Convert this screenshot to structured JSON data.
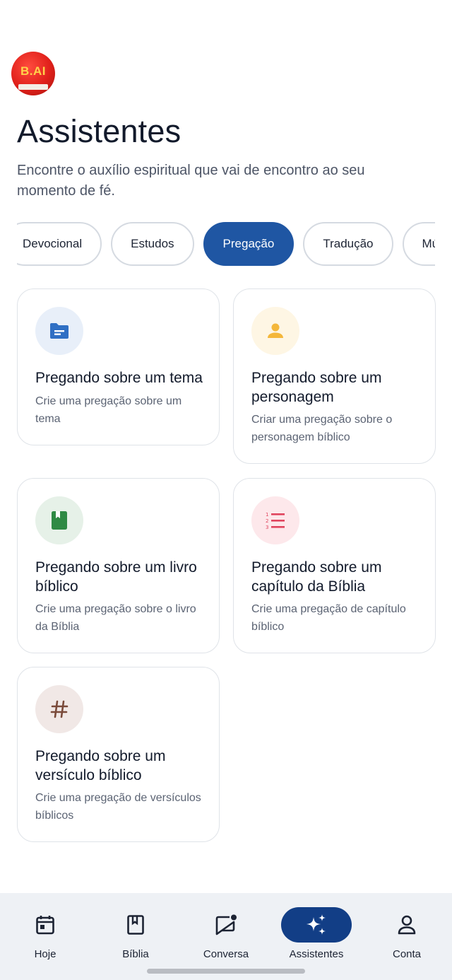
{
  "app": {
    "avatar_text": "B.AI"
  },
  "header": {
    "title": "Assistentes",
    "subtitle": "Encontre o auxílio espiritual que vai de encontro ao seu momento de fé."
  },
  "chips": [
    {
      "label": "Devocional",
      "active": false
    },
    {
      "label": "Estudos",
      "active": false
    },
    {
      "label": "Pregação",
      "active": true
    },
    {
      "label": "Tradução",
      "active": false
    },
    {
      "label": "Música",
      "active": false
    }
  ],
  "cards": [
    {
      "title": "Pregando sobre um tema",
      "description": "Crie uma pregação sobre um tema",
      "icon": "folder-icon",
      "color": "#2f6fc4",
      "bg": "#e8eff9"
    },
    {
      "title": "Pregando sobre um personagem",
      "description": "Criar uma pregação sobre o personagem bíblico",
      "icon": "person-icon",
      "color": "#f4b73a",
      "bg": "#fef6e4"
    },
    {
      "title": "Pregando sobre um livro bíblico",
      "description": "Crie uma pregação sobre o livro da Bíblia",
      "icon": "book-icon",
      "color": "#2f8a44",
      "bg": "#e6f1e8"
    },
    {
      "title": "Pregando sobre um capítulo da Bíblia",
      "description": "Crie uma pregação de capítulo bíblico",
      "icon": "numbered-list-icon",
      "color": "#e0445d",
      "bg": "#fde8eb"
    },
    {
      "title": "Pregando sobre um versículo bíblico",
      "description": "Crie uma pregação de versículos bíblicos",
      "icon": "hashtag-icon",
      "color": "#7a4a3a",
      "bg": "#f1e8e6"
    }
  ],
  "nav": [
    {
      "label": "Hoje",
      "icon": "calendar-icon",
      "active": false
    },
    {
      "label": "Bíblia",
      "icon": "bible-icon",
      "active": false
    },
    {
      "label": "Conversa",
      "icon": "chat-icon",
      "active": false
    },
    {
      "label": "Assistentes",
      "icon": "sparkles-icon",
      "active": true
    },
    {
      "label": "Conta",
      "icon": "account-icon",
      "active": false
    }
  ]
}
